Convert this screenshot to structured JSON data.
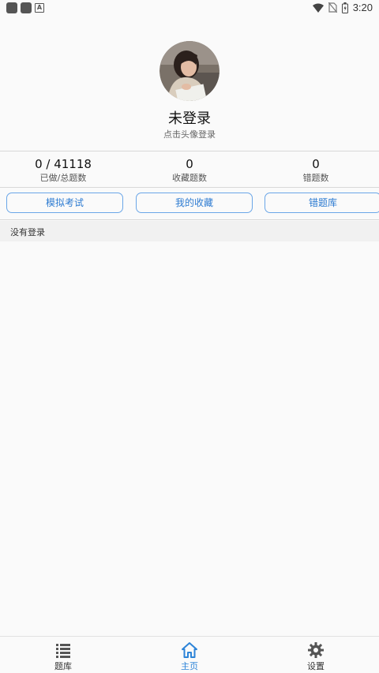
{
  "status_bar": {
    "time": "3:20",
    "icons": [
      "notification-square-icon",
      "notification-square-icon",
      "a-notification-icon",
      "wifi-icon",
      "no-sim-icon",
      "battery-icon"
    ]
  },
  "profile": {
    "title": "未登录",
    "hint": "点击头像登录"
  },
  "stats": [
    {
      "value": "0 / 41118",
      "label": "已做/总题数"
    },
    {
      "value": "0",
      "label": "收藏题数"
    },
    {
      "value": "0",
      "label": "错题数"
    }
  ],
  "actions": {
    "mock_exam": "模拟考试",
    "my_favorites": "我的收藏",
    "wrong_bank": "错题库"
  },
  "message": "没有登录",
  "bottom_nav": {
    "question_bank": "题库",
    "home": "主页",
    "settings": "设置",
    "active": "home",
    "accent_color": "#2d84d8"
  }
}
